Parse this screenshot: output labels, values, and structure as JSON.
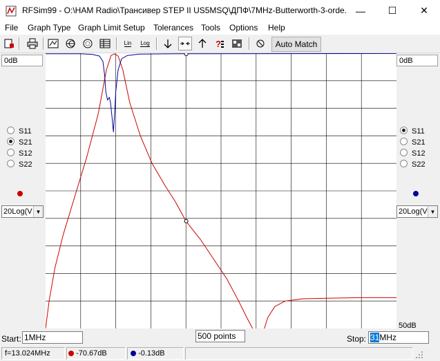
{
  "window": {
    "title": "RFSim99 - O:\\HAM Radio\\Трансивер STEP II US5MSQ\\ДПФ\\7MHz-Butterworth-3-orde...",
    "minimize_glyph": "—",
    "maximize_glyph": "☐",
    "close_glyph": "✕"
  },
  "menu": [
    {
      "label": "File"
    },
    {
      "label": "Graph Type"
    },
    {
      "label": "Graph Limit Setup"
    },
    {
      "label": "Tolerances"
    },
    {
      "label": "Tools"
    },
    {
      "label": "Options"
    },
    {
      "label": "Help"
    }
  ],
  "toolbar": {
    "lin_label": "Lin",
    "log_label": "Log",
    "auto_match_label": "Auto Match",
    "icons": [
      "print-icon",
      "printer-icon",
      "graph-icon",
      "smith-chart-icon",
      "polar-chart-icon",
      "table-icon",
      "lin-scale-icon",
      "log-scale-icon",
      "down-arrow-icon",
      "shrink-icon",
      "up-arrow-icon",
      "help-icon",
      "component-icon",
      "refresh-icon"
    ]
  },
  "left_panel": {
    "top_value": "0dB",
    "params": [
      "S11",
      "S21",
      "S12",
      "S22"
    ],
    "selected": "S21",
    "trace_color": "#cc0000",
    "scale_combo": "20Log(V"
  },
  "right_panel": {
    "top_value": "0dB",
    "bottom_value": "50dB",
    "params": [
      "S11",
      "S21",
      "S12",
      "S22"
    ],
    "selected": "S11",
    "trace_color": "#000099",
    "scale_combo": "20Log(V"
  },
  "sweep": {
    "start_label": "Start:",
    "start_value": "1MHz",
    "points_value": "500 points",
    "stop_label": "Stop:",
    "stop_value_selected": "31",
    "stop_value_rest": "MHz"
  },
  "status": {
    "frequency": "f=13.024MHz",
    "left_reading": "-70.67dB",
    "right_reading": "-0.13dB"
  },
  "chart_data": {
    "type": "line",
    "grid": true,
    "x_range_MHz": [
      1,
      31
    ],
    "y_range_dB": [
      -50,
      0
    ],
    "series": [
      {
        "color": "#cc0000",
        "points": [
          [
            1,
            -50
          ],
          [
            1.3,
            -45
          ],
          [
            1.8,
            -39
          ],
          [
            2.5,
            -33
          ],
          [
            3.5,
            -26
          ],
          [
            4.5,
            -19
          ],
          [
            5.5,
            -11
          ],
          [
            6.2,
            -3
          ],
          [
            6.6,
            -0.4
          ],
          [
            6.9,
            -0.1
          ],
          [
            7.2,
            -0.5
          ],
          [
            7.6,
            -3
          ],
          [
            8.2,
            -9
          ],
          [
            9.1,
            -15
          ],
          [
            10.1,
            -20
          ],
          [
            11.2,
            -24
          ],
          [
            12.1,
            -27
          ],
          [
            13.0,
            -30.5
          ],
          [
            14.3,
            -34
          ],
          [
            15.4,
            -37.5
          ],
          [
            16.5,
            -41
          ],
          [
            17.5,
            -45
          ],
          [
            18.2,
            -48
          ],
          [
            18.7,
            -50
          ]
        ]
      },
      {
        "color": "#cc0000",
        "points": [
          [
            19.7,
            -50
          ],
          [
            20.0,
            -48
          ],
          [
            20.6,
            -46
          ],
          [
            21.5,
            -45
          ],
          [
            23.0,
            -44.6
          ],
          [
            25.0,
            -44.5
          ],
          [
            28.0,
            -44.4
          ],
          [
            31.0,
            -44.4
          ]
        ]
      },
      {
        "color": "#000099",
        "points": [
          [
            1,
            -0.1
          ],
          [
            4,
            -0.1
          ],
          [
            5.0,
            -0.2
          ],
          [
            5.6,
            -0.5
          ],
          [
            5.9,
            -1.5
          ],
          [
            6.05,
            -4
          ],
          [
            6.15,
            -7
          ],
          [
            6.3,
            -8.5
          ],
          [
            6.45,
            -8
          ],
          [
            6.55,
            -9
          ],
          [
            6.7,
            -12
          ],
          [
            6.8,
            -14.3
          ],
          [
            6.9,
            -11
          ],
          [
            7.0,
            -7
          ],
          [
            7.2,
            -3
          ],
          [
            7.5,
            -1
          ],
          [
            8.0,
            -0.4
          ],
          [
            9.0,
            -0.15
          ],
          [
            12,
            -0.1
          ],
          [
            31,
            -0.05
          ]
        ]
      }
    ],
    "markers": [
      [
        13.024,
        -0.13
      ],
      [
        13.024,
        -30.5
      ]
    ]
  }
}
